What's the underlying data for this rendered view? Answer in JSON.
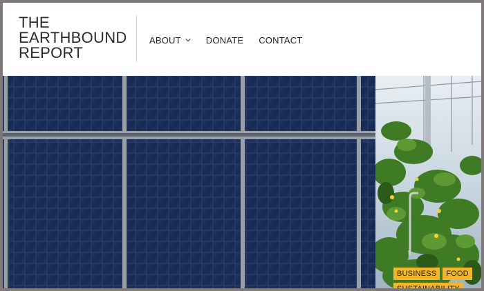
{
  "site": {
    "title_lines": [
      "THE",
      "EARTHBOUND",
      "REPORT"
    ]
  },
  "nav": {
    "items": [
      {
        "label": "ABOUT",
        "has_dropdown": true
      },
      {
        "label": "DONATE"
      },
      {
        "label": "CONTACT"
      }
    ]
  },
  "hero": {
    "tags": [
      "BUSINESS",
      "FOOD",
      "SUSTAINABILITY"
    ]
  },
  "colors": {
    "tag_bg": "#f2b52c",
    "panel_blue": "#1c2e55",
    "frame_border": "#7f7a79"
  }
}
